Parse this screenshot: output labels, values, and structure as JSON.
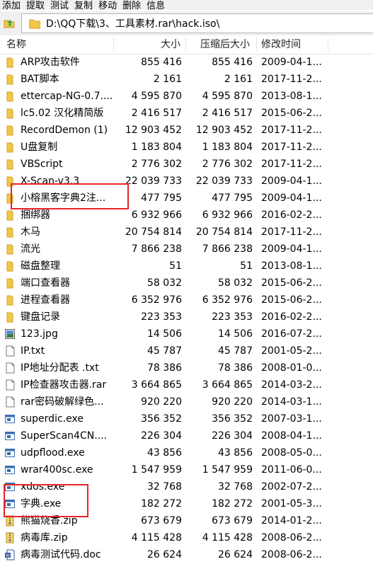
{
  "menu": [
    "添加",
    "提取",
    "测试",
    "复制",
    "移动",
    "删除",
    "信息"
  ],
  "address": {
    "path": "D:\\QQ下载\\3、工具素材.rar\\hack.iso\\"
  },
  "columns": {
    "name": "名称",
    "size": "大小",
    "compressed": "压缩后大小",
    "modified": "修改时间"
  },
  "files": [
    {
      "name": "ARP攻击软件",
      "size": "855 416",
      "packed": "855 416",
      "date": "2009-04-1...",
      "icon": "folder-icon"
    },
    {
      "name": "BAT脚本",
      "size": "2 161",
      "packed": "2 161",
      "date": "2017-11-2...",
      "icon": "folder-icon"
    },
    {
      "name": "ettercap-NG-0.7....",
      "size": "4 595 870",
      "packed": "4 595 870",
      "date": "2013-08-1...",
      "icon": "folder-icon"
    },
    {
      "name": "lc5.02 汉化精简版",
      "size": "2 416 517",
      "packed": "2 416 517",
      "date": "2015-06-2...",
      "icon": "folder-icon"
    },
    {
      "name": "RecordDemon (1)",
      "size": "12 903 452",
      "packed": "12 903 452",
      "date": "2017-11-2...",
      "icon": "folder-icon"
    },
    {
      "name": "U盘复制",
      "size": "1 183 804",
      "packed": "1 183 804",
      "date": "2017-11-2...",
      "icon": "folder-icon"
    },
    {
      "name": "VBScript",
      "size": "2 776 302",
      "packed": "2 776 302",
      "date": "2017-11-2...",
      "icon": "folder-icon"
    },
    {
      "name": "X-Scan-v3.3",
      "size": "22 039 733",
      "packed": "22 039 733",
      "date": "2009-04-1...",
      "icon": "folder-icon"
    },
    {
      "name": "小榕黑客字典2注...",
      "size": "477 795",
      "packed": "477 795",
      "date": "2009-04-1...",
      "icon": "folder-icon"
    },
    {
      "name": "捆绑器",
      "size": "6 932 966",
      "packed": "6 932 966",
      "date": "2016-02-2...",
      "icon": "folder-icon"
    },
    {
      "name": "木马",
      "size": "20 754 814",
      "packed": "20 754 814",
      "date": "2017-11-2...",
      "icon": "folder-icon"
    },
    {
      "name": "流光",
      "size": "7 866 238",
      "packed": "7 866 238",
      "date": "2009-04-1...",
      "icon": "folder-icon"
    },
    {
      "name": "磁盘整理",
      "size": "51",
      "packed": "51",
      "date": "2013-08-1...",
      "icon": "folder-icon"
    },
    {
      "name": "端口查看器",
      "size": "58 032",
      "packed": "58 032",
      "date": "2015-06-2...",
      "icon": "folder-icon"
    },
    {
      "name": "进程查看器",
      "size": "6 352 976",
      "packed": "6 352 976",
      "date": "2015-06-2...",
      "icon": "folder-icon"
    },
    {
      "name": "键盘记录",
      "size": "223 353",
      "packed": "223 353",
      "date": "2016-02-2...",
      "icon": "folder-icon"
    },
    {
      "name": "123.jpg",
      "size": "14 506",
      "packed": "14 506",
      "date": "2016-07-2...",
      "icon": "image-file-icon"
    },
    {
      "name": "IP.txt",
      "size": "45 787",
      "packed": "45 787",
      "date": "2001-05-2...",
      "icon": "text-file-icon"
    },
    {
      "name": "IP地址分配表 .txt",
      "size": "78 386",
      "packed": "78 386",
      "date": "2008-01-0...",
      "icon": "text-file-icon"
    },
    {
      "name": "IP检查器攻击器.rar",
      "size": "3 664 865",
      "packed": "3 664 865",
      "date": "2014-03-2...",
      "icon": "text-file-icon"
    },
    {
      "name": "rar密码破解绿色...",
      "size": "920 220",
      "packed": "920 220",
      "date": "2014-03-1...",
      "icon": "text-file-icon"
    },
    {
      "name": "superdic.exe",
      "size": "356 352",
      "packed": "356 352",
      "date": "2007-03-1...",
      "icon": "exe-file-icon"
    },
    {
      "name": "SuperScan4CN....",
      "size": "226 304",
      "packed": "226 304",
      "date": "2008-04-1...",
      "icon": "exe-file-icon"
    },
    {
      "name": "udpflood.exe",
      "size": "43 856",
      "packed": "43 856",
      "date": "2008-05-0...",
      "icon": "exe-file-icon"
    },
    {
      "name": "wrar400sc.exe",
      "size": "1 547 959",
      "packed": "1 547 959",
      "date": "2011-06-0...",
      "icon": "exe-file-icon"
    },
    {
      "name": "xdos.exe",
      "size": "32 768",
      "packed": "32 768",
      "date": "2002-07-2...",
      "icon": "exe-file-icon"
    },
    {
      "name": "字典.exe",
      "size": "182 272",
      "packed": "182 272",
      "date": "2001-05-3...",
      "icon": "exe-file-icon"
    },
    {
      "name": "熊猫烧香.zip",
      "size": "673 679",
      "packed": "673 679",
      "date": "2014-01-2...",
      "icon": "zip-file-icon"
    },
    {
      "name": "病毒库.zip",
      "size": "4 115 428",
      "packed": "4 115 428",
      "date": "2008-06-2...",
      "icon": "zip-file-icon"
    },
    {
      "name": "病毒测试代码.doc",
      "size": "26 624",
      "packed": "26 624",
      "date": "2008-06-2...",
      "icon": "doc-file-icon"
    }
  ],
  "colors": {
    "highlight_box": "#e8252a",
    "folder": "#f2c64b",
    "exe_blue": "#2a6ebd"
  }
}
